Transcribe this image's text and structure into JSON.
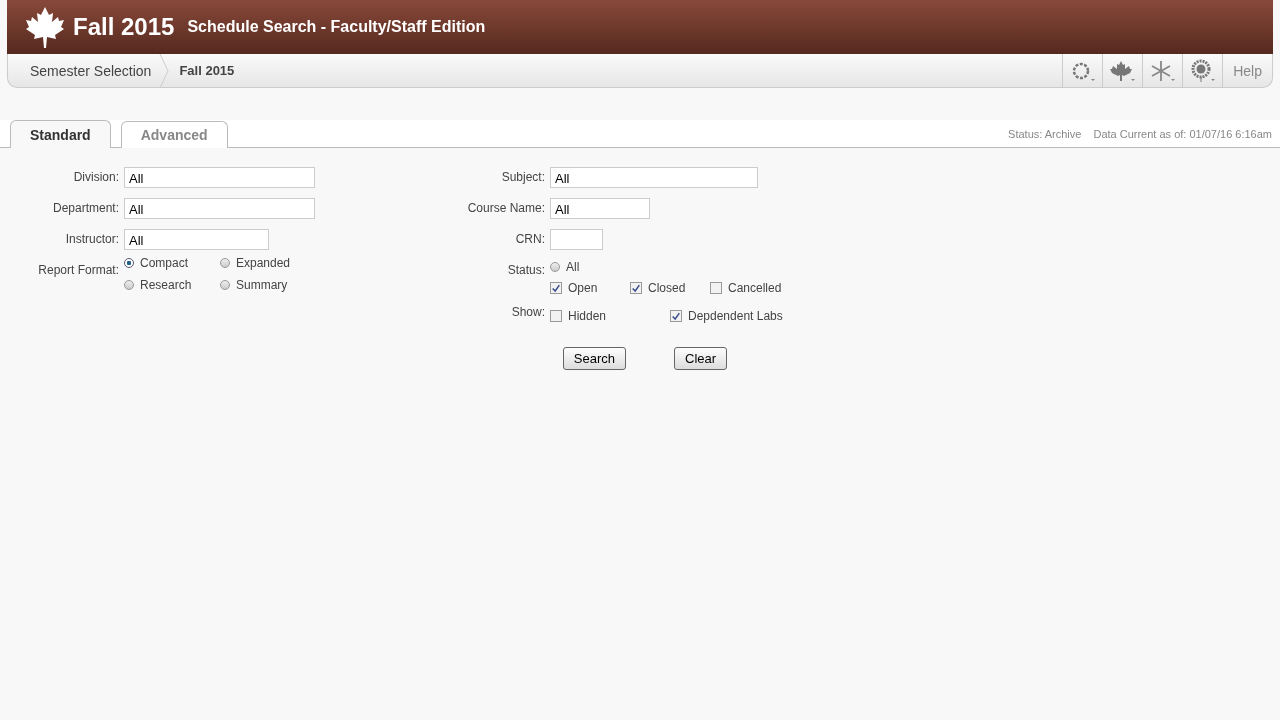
{
  "header": {
    "title": "Fall 2015",
    "subtitle": "Schedule Search - Faculty/Staff Edition"
  },
  "breadcrumb": [
    {
      "label": "Semester Selection"
    },
    {
      "label": "Fall 2015"
    }
  ],
  "toolbar": {
    "help": "Help"
  },
  "tabs": [
    {
      "label": "Standard",
      "selected": true
    },
    {
      "label": "Advanced",
      "selected": false
    }
  ],
  "status_info": {
    "status": "Status: Archive",
    "data_current": "Data Current as of: 01/07/16 6:16am"
  },
  "left_fields": [
    {
      "label": "Division:",
      "value": "All"
    },
    {
      "label": "Department:",
      "value": "All"
    },
    {
      "label": "Instructor:",
      "value": "All"
    }
  ],
  "report_format": {
    "label": "Report Format:",
    "options": [
      {
        "label": "Compact",
        "selected": true
      },
      {
        "label": "Expanded",
        "selected": false
      },
      {
        "label": "Research",
        "selected": false
      },
      {
        "label": "Summary",
        "selected": false
      }
    ]
  },
  "right_fields": [
    {
      "label": "Subject:",
      "value": "All"
    },
    {
      "label": "Course Name:",
      "value": "All"
    },
    {
      "label": "CRN:"
    }
  ],
  "status": {
    "label": "Status:",
    "all": {
      "label": "All",
      "selected": false
    },
    "options": [
      {
        "label": "Open",
        "checked": true
      },
      {
        "label": "Closed",
        "checked": true
      },
      {
        "label": "Cancelled",
        "checked": false
      }
    ]
  },
  "show": {
    "label": "Show:",
    "options": [
      {
        "label": "Hidden",
        "checked": false
      },
      {
        "label": "Depdendent Labs",
        "checked": true
      }
    ]
  },
  "buttons": [
    "Search",
    "Clear"
  ]
}
